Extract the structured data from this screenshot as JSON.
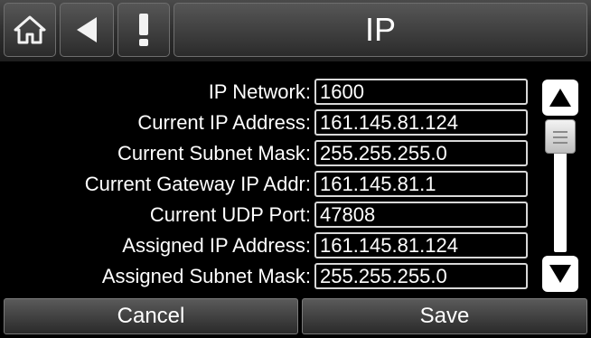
{
  "header": {
    "title": "IP",
    "icons": [
      "home-icon",
      "back-arrow-icon",
      "alert-icon"
    ]
  },
  "fields": [
    {
      "label": "IP Network:",
      "value": "1600"
    },
    {
      "label": "Current IP Address:",
      "value": "161.145.81.124"
    },
    {
      "label": "Current Subnet Mask:",
      "value": "255.255.255.0"
    },
    {
      "label": "Current Gateway IP Addr:",
      "value": "161.145.81.1"
    },
    {
      "label": "Current UDP Port:",
      "value": "47808"
    },
    {
      "label": "Assigned IP Address:",
      "value": "161.145.81.124"
    },
    {
      "label": "Assigned Subnet Mask:",
      "value": "255.255.255.0"
    }
  ],
  "scrollbar": {
    "icons": [
      "scroll-up-arrow-icon",
      "scroll-down-arrow-icon"
    ],
    "position": 0
  },
  "footer": {
    "cancel_label": "Cancel",
    "save_label": "Save"
  },
  "colors": {
    "background": "#000000",
    "text": "#ffffff",
    "button_gradient_top": "#5a5a5a",
    "button_gradient_bottom": "#2a2a2a"
  }
}
